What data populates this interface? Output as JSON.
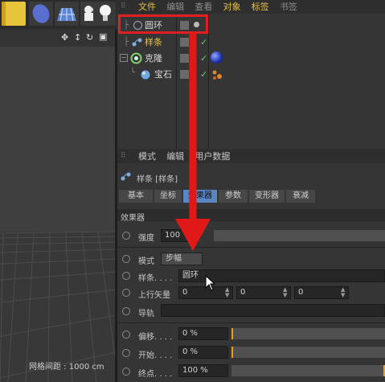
{
  "viewport": {
    "grid_label": "网格间距 : 1000 cm"
  },
  "object_manager": {
    "menu": [
      "文件",
      "编辑",
      "查看",
      "对象",
      "标签",
      "书签"
    ],
    "objects": [
      {
        "name": "圆环"
      },
      {
        "name": "样条"
      },
      {
        "name": "克隆"
      },
      {
        "name": "宝石"
      }
    ]
  },
  "attribute_manager": {
    "menu": [
      "模式",
      "编辑",
      "用户数据"
    ],
    "object_title": "样条 [样条]",
    "tabs": [
      "基本",
      "坐标",
      "效果器",
      "参数",
      "变形器",
      "衰减"
    ],
    "active_tab": "效果器",
    "section": "效果器",
    "strength": {
      "label": "强度",
      "value": "100"
    },
    "mode": {
      "label": "模式",
      "value": "步幅"
    },
    "spline": {
      "label": "样条. . . .",
      "value": "圆环"
    },
    "up_vector": {
      "label": "上行矢量",
      "values": [
        "0",
        "0",
        "0"
      ]
    },
    "rail": {
      "label": "导轨"
    },
    "offset": {
      "label": "偏移. . . .",
      "value": "0 %",
      "fill": 0.0
    },
    "start": {
      "label": "开始. . . .",
      "value": "0 %",
      "fill": 0.0
    },
    "end": {
      "label": "终点. . . .",
      "value": "100 %",
      "fill": 1.0
    }
  },
  "colors": {
    "highlight_red": "#e02020",
    "accent_yellow": "#e8c040",
    "check_green": "#5dd65d"
  }
}
